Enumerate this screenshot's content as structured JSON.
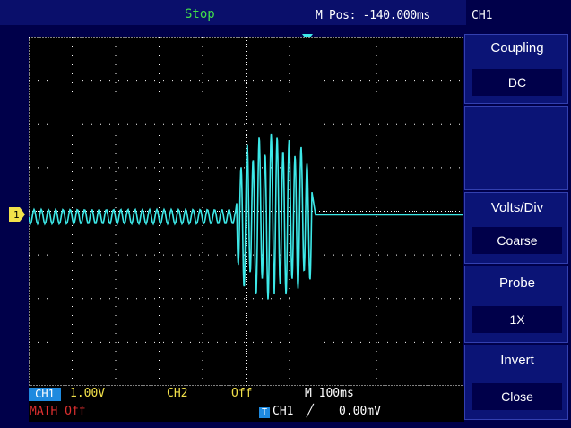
{
  "status": {
    "run_state": "Stop",
    "mpos": "M Pos: -140.000ms",
    "channel": "CH1"
  },
  "menu": {
    "coupling": {
      "title": "Coupling",
      "value": "DC"
    },
    "volts_div": {
      "title": "Volts/Div",
      "value": "Coarse"
    },
    "probe": {
      "title": "Probe",
      "value": "1X"
    },
    "invert": {
      "title": "Invert",
      "value": "Close"
    }
  },
  "bottom": {
    "ch1_label": "CH1",
    "ch1_scale": "1.00V",
    "ch2_label": "CH2",
    "ch2_state": "Off",
    "timebase": "M 100ms",
    "math": "MATH Off",
    "trigger_icon": "T",
    "trigger_source": "CH1",
    "trigger_edge": "╱",
    "trigger_level": "0.00mV"
  },
  "channel_marker": "1",
  "colors": {
    "trace": "#3de8e8",
    "status": "#42e04a",
    "ch1": "#1e8adf",
    "math": "#e03030",
    "ch2": "#f2e14a"
  }
}
